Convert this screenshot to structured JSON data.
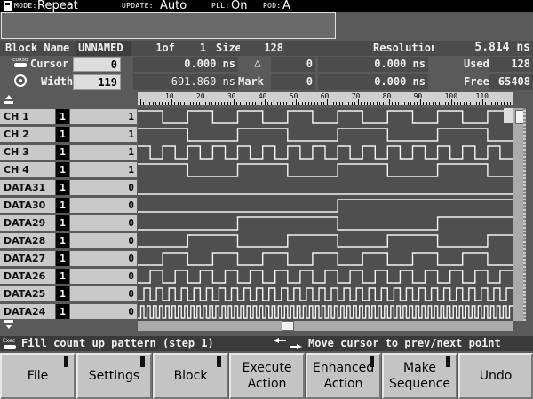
{
  "status": {
    "mode_label": "MODE:",
    "mode_value": "Repeat",
    "update_label": "UPDATE:",
    "update_value": "Auto",
    "pll_label": "PLL:",
    "pll_value": "On",
    "pod_label": "POD:",
    "pod_value": "A"
  },
  "block": {
    "name_label": "Block Name",
    "name_value": "UNNAMED",
    "index": "1of",
    "total": "1",
    "size_label": "Size",
    "size_value": "128",
    "resolution_label": "Resolution",
    "resolution_value": "5.814 ns"
  },
  "cursor": {
    "label": "Cursor",
    "value": "0",
    "time": "0.000 ns",
    "delta_symbol": "△",
    "delta_value": "0",
    "delta_time": "0.000 ns",
    "used_label": "Used",
    "used_value": "128"
  },
  "width": {
    "label": "Width",
    "value": "119",
    "time": "691.860 ns",
    "mark_label": "Mark",
    "mark_value": "0",
    "mark_time": "0.000 ns",
    "free_label": "Free",
    "free_value": "65408"
  },
  "ruler": [
    "10",
    "20",
    "30",
    "40",
    "50",
    "60",
    "70",
    "80",
    "90",
    "100",
    "110"
  ],
  "channels": [
    {
      "name": "CH 1",
      "bit": "1",
      "value": "1"
    },
    {
      "name": "CH 2",
      "bit": "1",
      "value": "1"
    },
    {
      "name": "CH 3",
      "bit": "1",
      "value": "1"
    },
    {
      "name": "CH 4",
      "bit": "1",
      "value": "1"
    },
    {
      "name": "DATA31",
      "bit": "1",
      "value": "0"
    },
    {
      "name": "DATA30",
      "bit": "1",
      "value": "0"
    },
    {
      "name": "DATA29",
      "bit": "1",
      "value": "0"
    },
    {
      "name": "DATA28",
      "bit": "1",
      "value": "0"
    },
    {
      "name": "DATA27",
      "bit": "1",
      "value": "0"
    },
    {
      "name": "DATA26",
      "bit": "1",
      "value": "0"
    },
    {
      "name": "DATA25",
      "bit": "1",
      "value": "0"
    },
    {
      "name": "DATA24",
      "bit": "1",
      "value": "0"
    }
  ],
  "hints": {
    "exec_label": "Exec",
    "left": "Fill count up pattern (step 1)",
    "right": "Move cursor to prev/next point"
  },
  "softkeys": [
    {
      "line1": "File",
      "line2": ""
    },
    {
      "line1": "Settings",
      "line2": ""
    },
    {
      "line1": "Block",
      "line2": ""
    },
    {
      "line1": "Execute",
      "line2": "Action"
    },
    {
      "line1": "Enhanced",
      "line2": "Action"
    },
    {
      "line1": "Make",
      "line2": "Sequence"
    },
    {
      "line1": "Undo",
      "line2": ""
    }
  ],
  "icons": {
    "cursor": "cursor-icon",
    "width": "width-icon",
    "scroll_up": "scroll-up-icon",
    "scroll_down": "scroll-down-icon",
    "exec": "exec-icon",
    "arrows": "left-right-arrows-icon",
    "pod": "pod-icon"
  }
}
